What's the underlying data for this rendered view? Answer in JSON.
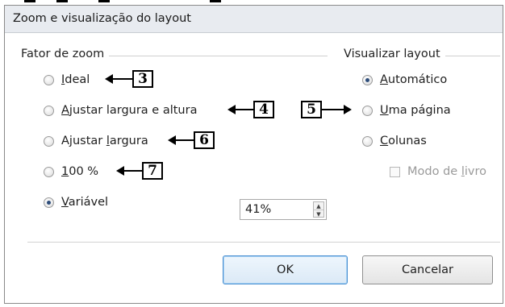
{
  "dialog": {
    "title": "Zoom e visualização do layout"
  },
  "zoom_group": {
    "label": "Fator de zoom",
    "options": [
      {
        "mnemonic": "I",
        "rest": "deal",
        "checked": false
      },
      {
        "mnemonic": "A",
        "rest": "justar largura e altura",
        "checked": false
      },
      {
        "pre": "Ajustar ",
        "mnemonic": "l",
        "rest": "argura",
        "checked": false
      },
      {
        "mnemonic": "1",
        "rest": "00 %",
        "checked": false
      },
      {
        "mnemonic": "V",
        "rest": "ariável",
        "checked": true
      }
    ],
    "variable_value": "41%"
  },
  "layout_group": {
    "label": "Visualizar layout",
    "options": [
      {
        "mnemonic": "A",
        "rest": "utomático",
        "checked": true
      },
      {
        "mnemonic": "U",
        "rest": "ma página",
        "checked": false
      },
      {
        "mnemonic": "C",
        "rest": "olunas",
        "checked": false
      }
    ],
    "book_mode": {
      "pre": "Modo de ",
      "mnemonic": "l",
      "rest": "ivro",
      "checked": false,
      "enabled": false
    }
  },
  "callouts": [
    "3",
    "4",
    "5",
    "6",
    "7"
  ],
  "buttons": {
    "ok": "OK",
    "cancel": "Cancelar"
  }
}
